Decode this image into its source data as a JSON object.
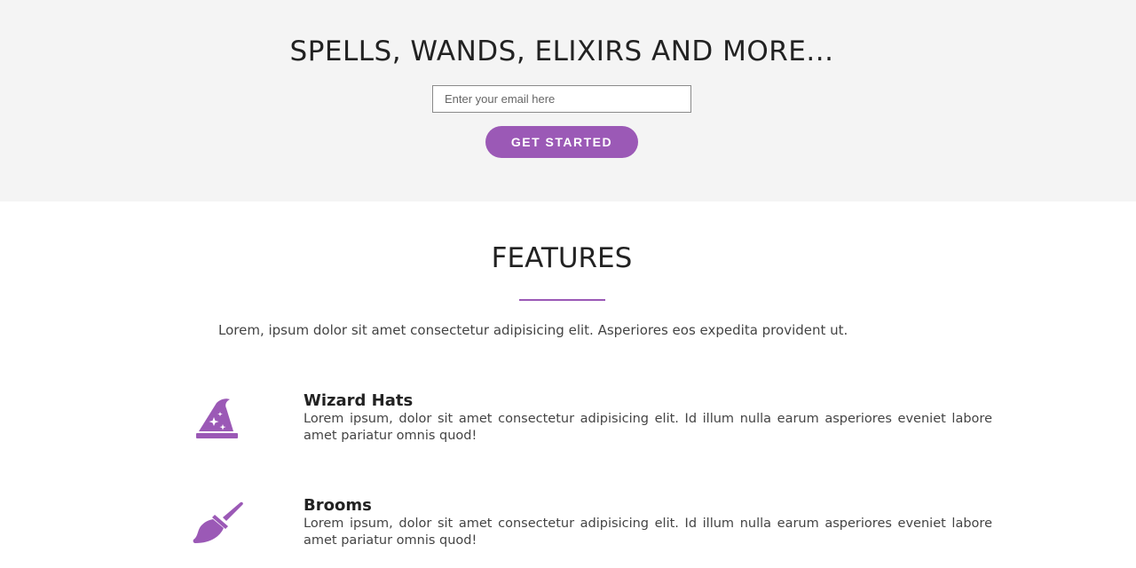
{
  "hero": {
    "title": "SPELLS, WANDS, ELIXIRS AND MORE...",
    "email_placeholder": "Enter your email here",
    "cta_label": "GET STARTED"
  },
  "features": {
    "title": "FEATURES",
    "intro": "Lorem, ipsum dolor sit amet consectetur adipisicing elit. Asperiores eos expedita provident ut.",
    "items": [
      {
        "icon": "wizard-hat-icon",
        "name": "Wizard Hats",
        "description": "Lorem ipsum, dolor sit amet consectetur adipisicing elit. Id illum nulla earum asperiores eveniet labore amet pariatur omnis quod!"
      },
      {
        "icon": "broom-icon",
        "name": "Brooms",
        "description": "Lorem ipsum, dolor sit amet consectetur adipisicing elit. Id illum nulla earum asperiores eveniet labore amet pariatur omnis quod!"
      }
    ]
  },
  "colors": {
    "accent": "#9b59b6",
    "hero_background": "#f4f4f4"
  }
}
